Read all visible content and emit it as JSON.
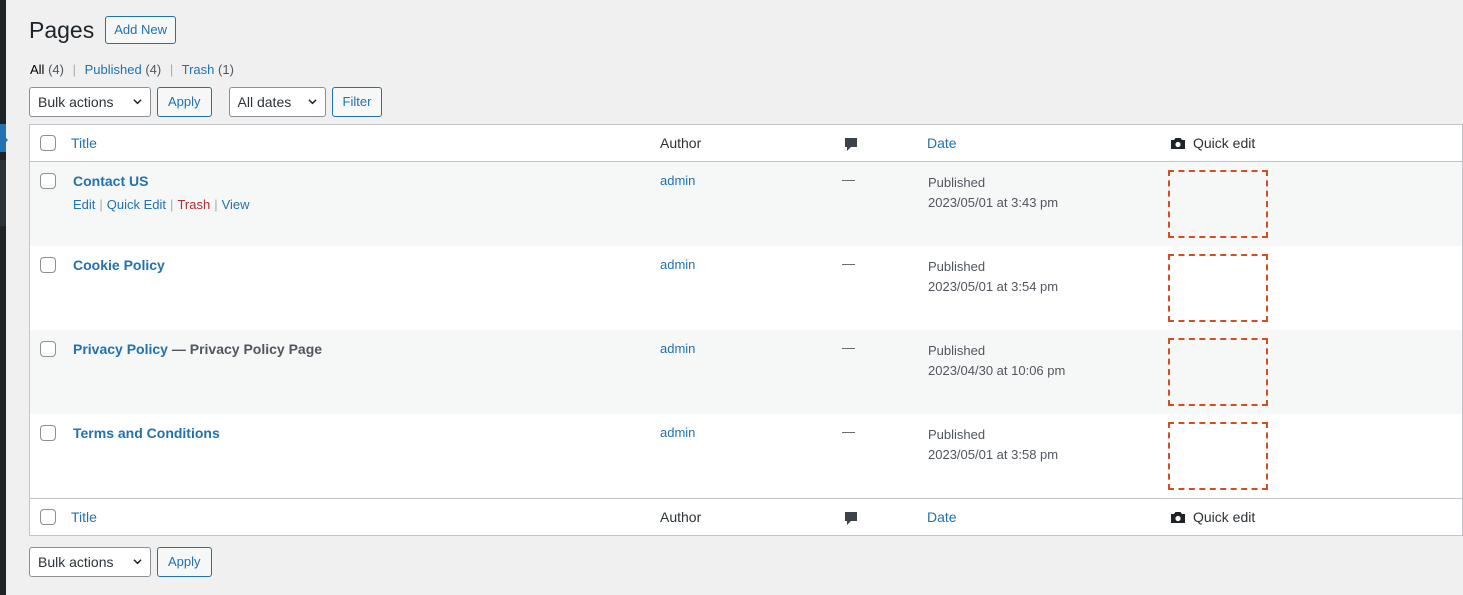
{
  "header": {
    "title": "Pages",
    "add_new_label": "Add New"
  },
  "views": [
    {
      "label": "All",
      "count": "(4)",
      "current": true
    },
    {
      "label": "Published",
      "count": "(4)"
    },
    {
      "label": "Trash",
      "count": "(1)"
    }
  ],
  "view_separator": "|",
  "top_nav": {
    "bulk_actions": "Bulk actions",
    "apply_label": "Apply",
    "dates": "All dates",
    "filter_label": "Filter"
  },
  "bottom_nav": {
    "bulk_actions": "Bulk actions",
    "apply_label": "Apply"
  },
  "columns": {
    "title": "Title",
    "author": "Author",
    "date": "Date",
    "quick_edit": "Quick edit"
  },
  "row_actions": {
    "edit": "Edit",
    "quick_edit": "Quick Edit",
    "trash": "Trash",
    "view": "View",
    "separator": "|"
  },
  "rows": [
    {
      "title": "Contact US",
      "state": "",
      "author": "admin",
      "comments": "—",
      "status": "Published",
      "date": "2023/05/01 at 3:43 pm"
    },
    {
      "title": "Cookie Policy",
      "state": "",
      "author": "admin",
      "comments": "—",
      "status": "Published",
      "date": "2023/05/01 at 3:54 pm"
    },
    {
      "title": "Privacy Policy",
      "state": " — Privacy Policy Page",
      "author": "admin",
      "comments": "—",
      "status": "Published",
      "date": "2023/04/30 at 10:06 pm"
    },
    {
      "title": "Terms and Conditions",
      "state": "",
      "author": "admin",
      "comments": "—",
      "status": "Published",
      "date": "2023/05/01 at 3:58 pm"
    }
  ],
  "colors": {
    "link": "#2271b1",
    "trash": "#b32d2e",
    "quick_edit_border": "#d54e21"
  }
}
